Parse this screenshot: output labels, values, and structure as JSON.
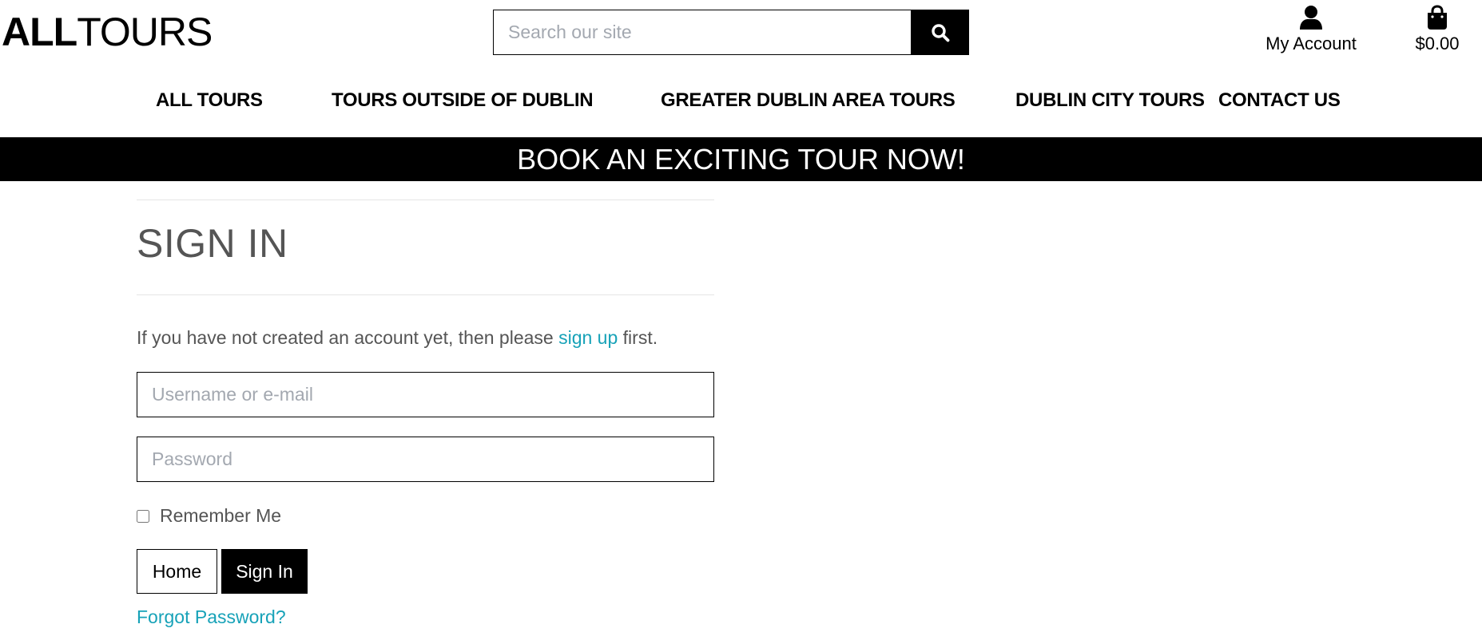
{
  "header": {
    "logo_bold": "ALL",
    "logo_light": "TOURS",
    "search": {
      "placeholder": "Search our site",
      "value": ""
    },
    "account_label": "My Account",
    "cart_total": "$0.00"
  },
  "nav": {
    "items": [
      {
        "label": "ALL TOURS"
      },
      {
        "label": "TOURS OUTSIDE OF DUBLIN"
      },
      {
        "label": "GREATER DUBLIN AREA TOURS"
      },
      {
        "label": "DUBLIN CITY TOURS"
      },
      {
        "label": "CONTACT US"
      }
    ]
  },
  "banner": {
    "text": "BOOK AN EXCITING TOUR NOW!"
  },
  "signin": {
    "title": "SIGN IN",
    "intro_prefix": "If you have not created an account yet, then please ",
    "intro_link": "sign up",
    "intro_suffix": " first.",
    "username_placeholder": "Username or e-mail",
    "password_placeholder": "Password",
    "remember_label": "Remember Me",
    "remember_checked": false,
    "home_button": "Home",
    "signin_button": "Sign In",
    "forgot_link": "Forgot Password?"
  },
  "colors": {
    "accent_link": "#17a2b8",
    "banner_bg": "#000000",
    "muted_text": "#555555"
  },
  "icons": {
    "search": "search-icon",
    "account": "user-icon",
    "cart": "shopping-bag-icon"
  }
}
